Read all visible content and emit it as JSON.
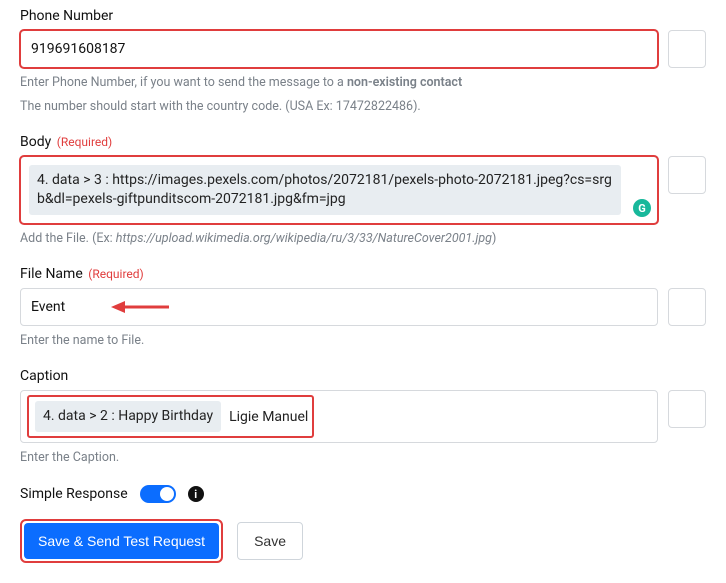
{
  "phone": {
    "label": "Phone Number",
    "value": "919691608187",
    "help_prefix": "Enter Phone Number, if you want to send the message to a ",
    "help_strong": "non-existing contact",
    "help_line2": "The number should start with the country code. (USA Ex: 17472822486)."
  },
  "body": {
    "label": "Body",
    "required": "(Required)",
    "chip": "4. data > 3 : https://images.pexels.com/photos/2072181/pexels-photo-2072181.jpeg?cs=srgb&dl=pexels-giftpundits­com-2072181.jpg&fm=jpg",
    "help_prefix": "Add the File. (Ex: ",
    "help_ital": "https://upload.wikimedia.org/wikipedia/ru/3/33/NatureCover2001.jpg",
    "help_suffix": ")"
  },
  "filename": {
    "label": "File Name",
    "required": "(Required)",
    "value": "Event",
    "help": "Enter the name to File."
  },
  "caption": {
    "label": "Caption",
    "chip": "4. data > 2 : Happy Birthday",
    "extra_text": "Ligie Manuel",
    "help": "Enter the Caption."
  },
  "simple_response": {
    "label": "Simple Response"
  },
  "buttons": {
    "save_send": "Save & Send Test Request",
    "save": "Save"
  },
  "icons": {
    "grammarly": "G",
    "info": "i"
  }
}
